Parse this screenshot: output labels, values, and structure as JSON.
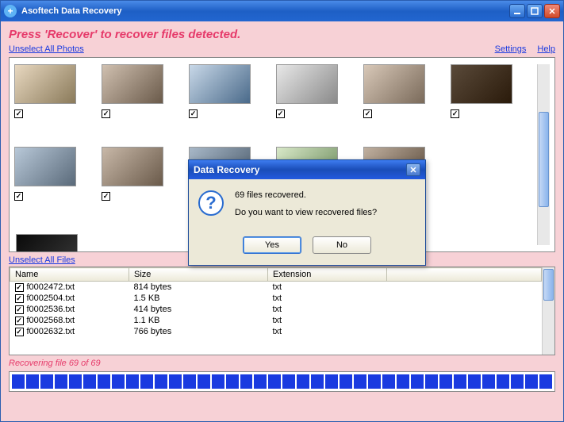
{
  "titlebar": {
    "app_title": "Asoftech Data Recovery"
  },
  "subtitle": "Press 'Recover' to recover files detected.",
  "links": {
    "unselect_photos": "Unselect All Photos",
    "unselect_files": "Unselect All Files",
    "settings": "Settings",
    "help": "Help"
  },
  "photos": [
    {
      "checked": true
    },
    {
      "checked": true
    },
    {
      "checked": true
    },
    {
      "checked": true
    },
    {
      "checked": true
    },
    {
      "checked": true
    },
    {
      "checked": true
    },
    {
      "checked": true
    },
    {
      "checked": true
    },
    {
      "checked": true
    },
    {
      "checked": true
    },
    {
      "checked": false
    }
  ],
  "file_table": {
    "headers": {
      "name": "Name",
      "size": "Size",
      "extension": "Extension"
    },
    "rows": [
      {
        "checked": true,
        "name": "f0002472.txt",
        "size": "814 bytes",
        "ext": "txt"
      },
      {
        "checked": true,
        "name": "f0002504.txt",
        "size": "1.5 KB",
        "ext": "txt"
      },
      {
        "checked": true,
        "name": "f0002536.txt",
        "size": "414 bytes",
        "ext": "txt"
      },
      {
        "checked": true,
        "name": "f0002568.txt",
        "size": "1.1 KB",
        "ext": "txt"
      },
      {
        "checked": true,
        "name": "f0002632.txt",
        "size": "766 bytes",
        "ext": "txt"
      }
    ]
  },
  "status": "Recovering file 69 of 69",
  "progress_segments": 38,
  "dialog": {
    "title": "Data Recovery",
    "line1": "69 files recovered.",
    "line2": "Do you want to view recovered files?",
    "yes": "Yes",
    "no": "No"
  }
}
